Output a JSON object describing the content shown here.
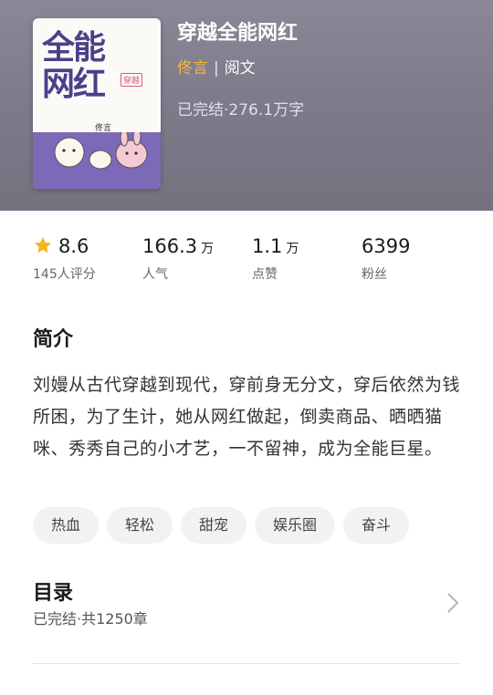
{
  "book": {
    "title": "穿越全能网红",
    "author": "佟言",
    "separator": "|",
    "publisher": "阅文",
    "status": "已完结·276.1万字",
    "cover": {
      "title_line1": "全能",
      "title_line2": "网红",
      "badge": "穿越",
      "author": "佟言"
    }
  },
  "stats": {
    "rating": {
      "value": "8.6",
      "label": "145人评分"
    },
    "popularity": {
      "value": "166.3",
      "unit": "万",
      "label": "人气"
    },
    "likes": {
      "value": "1.1",
      "unit": "万",
      "label": "点赞"
    },
    "fans": {
      "value": "6399",
      "label": "粉丝"
    }
  },
  "intro": {
    "heading": "简介",
    "text": "刘嫚从古代穿越到现代，穿前身无分文，穿后依然为钱所困，为了生计，她从网红做起，倒卖商品、晒晒猫咪、秀秀自己的小才艺，一不留神，成为全能巨星。"
  },
  "tags": [
    "热血",
    "轻松",
    "甜宠",
    "娱乐圈",
    "奋斗"
  ],
  "catalog": {
    "heading": "目录",
    "status": "已完结·共1250章"
  },
  "colors": {
    "header_bg": "#7c7989",
    "author_accent": "#f5b63b",
    "star": "#f5b31b",
    "tag_bg": "#f2f2f2",
    "cover_bottom": "#7c69b8"
  },
  "icons": [
    "star-icon",
    "chevron-right-icon"
  ]
}
